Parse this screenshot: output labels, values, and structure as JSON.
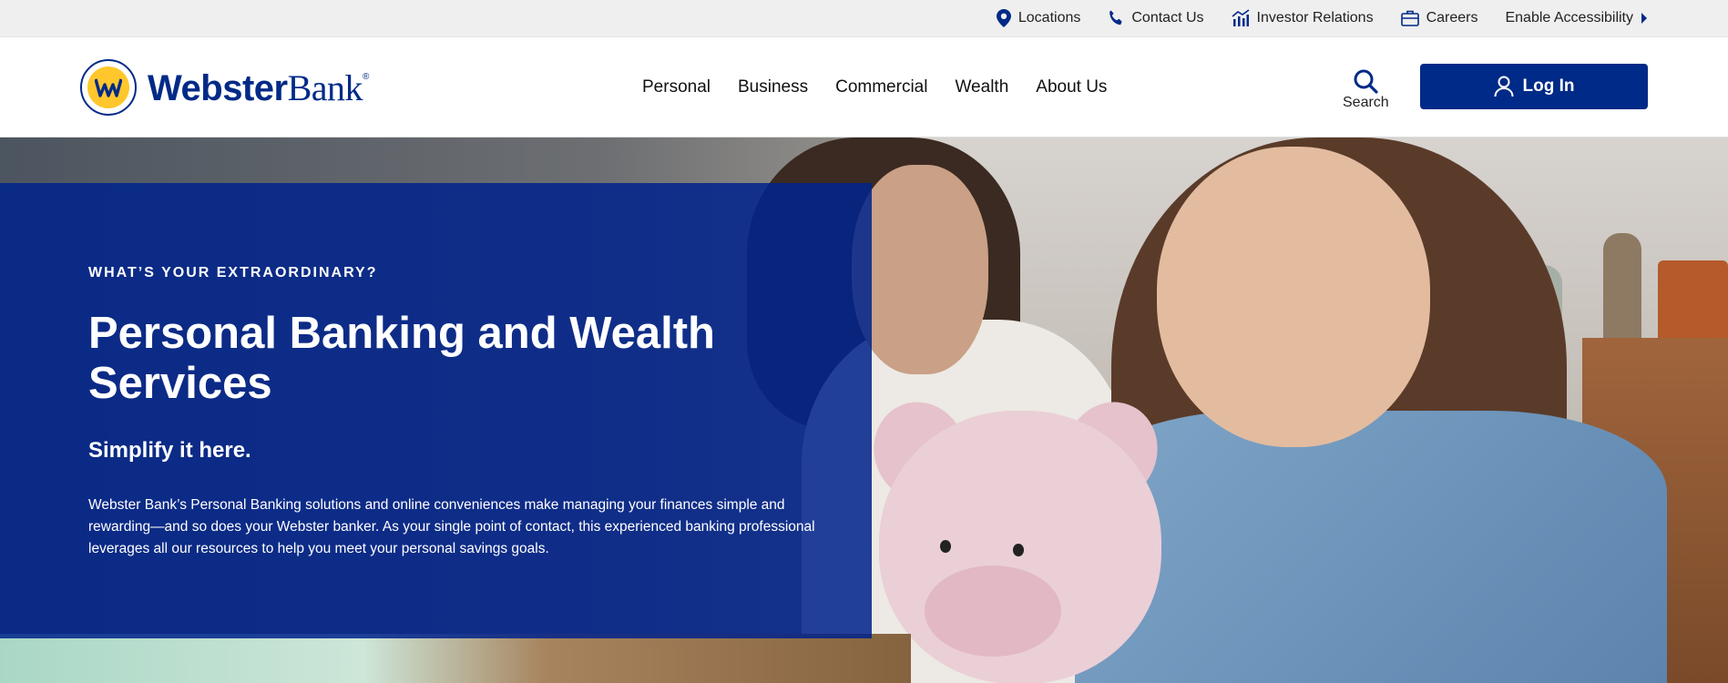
{
  "utility": {
    "links": [
      {
        "label": "Locations",
        "icon": "location-pin-icon"
      },
      {
        "label": "Contact Us",
        "icon": "phone-icon"
      },
      {
        "label": "Investor Relations",
        "icon": "investor-chart-icon"
      },
      {
        "label": "Careers",
        "icon": "briefcase-icon"
      },
      {
        "label": "Enable Accessibility",
        "icon": "caret-right-icon"
      }
    ]
  },
  "header": {
    "logo": {
      "word1": "Webster",
      "word2": "Bank",
      "mark": "®"
    },
    "nav": [
      "Personal",
      "Business",
      "Commercial",
      "Wealth",
      "About Us"
    ],
    "search_label": "Search",
    "login_label": "Log In"
  },
  "hero": {
    "eyebrow": "WHAT’S YOUR EXTRAORDINARY?",
    "title": "Personal Banking and Wealth Services",
    "subtitle": "Simplify it here.",
    "body": "Webster Bank’s Personal Banking solutions and online conveniences make managing your finances simple and rewarding—and so does your Webster banker. As your single point of contact, this experienced banking professional leverages all our resources to help you meet your personal savings goals."
  },
  "colors": {
    "brand_blue": "#002a87",
    "brand_yellow": "#ffc72c"
  }
}
